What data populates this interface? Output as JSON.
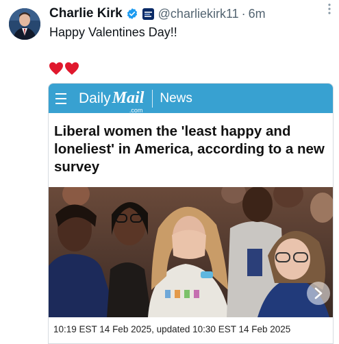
{
  "tweet": {
    "author_name": "Charlie Kirk",
    "handle": "@charliekirk11",
    "separator": "·",
    "time_ago": "6m",
    "text": "Happy Valentines Day!!",
    "emoji": [
      "red-heart",
      "red-heart"
    ]
  },
  "card": {
    "brand_daily": "Daily",
    "brand_mail": "Mail",
    "brand_com": ".com",
    "section": "News",
    "headline": "Liberal women the 'least happy and loneliest' in America, according to a new survey",
    "caption": "10:19 EST 14 Feb 2025, updated 10:30 EST 14 Feb 2025"
  },
  "colors": {
    "verified_blue": "#1d9bf0",
    "mail_bar": "#38a1d1",
    "heart_red": "#e0182d"
  },
  "icons": [
    "avatar",
    "verified-icon",
    "affiliate-badge-icon",
    "more-icon",
    "menu-icon",
    "chevron-right-icon"
  ]
}
